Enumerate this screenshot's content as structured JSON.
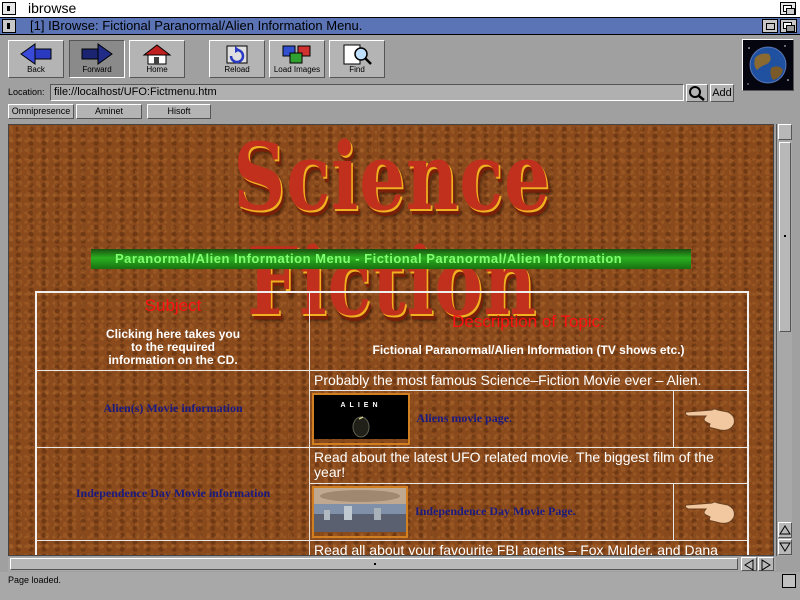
{
  "screen": {
    "title": "ibrowse"
  },
  "window": {
    "title": "[1] IBrowse:  Fictional Paranormal/Alien Information Menu."
  },
  "toolbar": {
    "back": "Back",
    "forward": "Forward",
    "home": "Home",
    "reload": "Reload",
    "load_images": "Load Images",
    "find": "Find"
  },
  "location": {
    "label": "Location:",
    "url": "file://localhost/UFO:Fictmenu.htm",
    "add": "Add"
  },
  "hotlist": [
    "Omnipresence",
    "Aminet",
    "Hisoft"
  ],
  "page": {
    "banner": "Science Fiction",
    "subbanner": "Paranormal/Alien Information Menu - Fictional Paranormal/Alien Information",
    "header_subject": "Subject",
    "header_subject_note": "Clicking here takes you to the required information on the CD.",
    "header_desc": "Description of Topic:",
    "header_desc_note": "Fictional Paranormal/Alien Information (TV shows etc.)",
    "rows": [
      {
        "subject": "Alien(s) Movie information",
        "description": "Probably the most famous Science–Fiction Movie ever – Alien.",
        "link": "Aliens movie page.",
        "thumb_text": "ALIEN"
      },
      {
        "subject": "Independence Day Movie information",
        "description": "Read about the latest UFO related movie. The biggest film of the year!",
        "link": "Independence Day Movie Page.",
        "thumb_text": ""
      }
    ],
    "partial_row": "Read all about your favourite FBI agents – Fox Mulder, and Dana"
  },
  "status": {
    "text": "Page loaded."
  },
  "icons": [
    "back-arrow-icon",
    "forward-arrow-icon",
    "home-icon",
    "reload-icon",
    "load-images-icon",
    "find-icon",
    "search-icon",
    "pointing-hand-icon",
    "globe-icon"
  ]
}
